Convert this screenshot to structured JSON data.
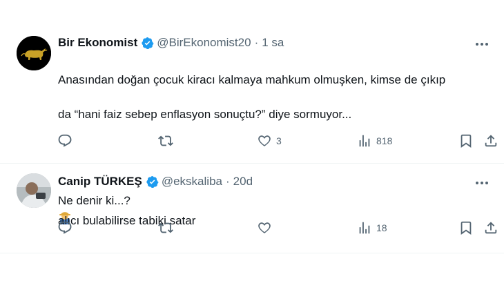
{
  "tweets": [
    {
      "name": "Bir Ekonomist",
      "handle": "@BirEkonomist20",
      "separator": "·",
      "time": "1 sa",
      "text_line1": "Anasından doğan çocuk kiracı kalmaya mahkum olmuşken, kimse de çıkıp",
      "text_line2": "da “hani faiz sebep enflasyon sonuçtu?” diye sormuyor...",
      "text_line3": "Ne denir ki...?",
      "emoji": "man-farmer-emoji",
      "likes": "3",
      "views": "818",
      "replies": "",
      "retweets": ""
    },
    {
      "name": "Canip TÜRKEŞ",
      "handle": "@ekskaliba",
      "separator": "·",
      "time": "20d",
      "text_line1": "alıcı bulabilirse tabiki satar",
      "likes": "",
      "views": "18",
      "replies": "",
      "retweets": ""
    }
  ],
  "colors": {
    "text_primary": "#0f1419",
    "text_secondary": "#536471",
    "verified_blue": "#1d9bf0",
    "divider": "#eff3f4",
    "avatar1_bg": "#000000",
    "avatar1_bull": "#c9a227"
  },
  "icons": [
    "reply-icon",
    "retweet-icon",
    "like-icon",
    "views-icon",
    "bookmark-icon",
    "share-icon",
    "more-icon",
    "verified-badge-icon"
  ]
}
